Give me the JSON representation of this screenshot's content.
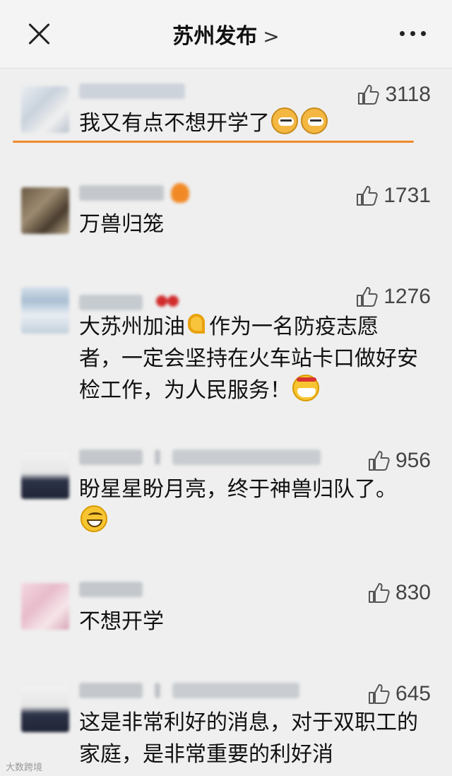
{
  "header": {
    "title": "苏州发布",
    "title_chevron": ">"
  },
  "comments": [
    {
      "text": "我又有点不想开学了",
      "likes": "3118"
    },
    {
      "text": "万兽归笼",
      "likes": "1731"
    },
    {
      "text_a": "大苏州加油",
      "text_b": "作为一名防疫志愿者，一定会坚持在火车站卡口做好安检工作，为人民服务！",
      "likes": "1276"
    },
    {
      "text": "盼星星盼月亮，终于神兽归队了。",
      "likes": "956"
    },
    {
      "text": "不想开学",
      "likes": "830"
    },
    {
      "text": "这是非常利好的消息，对于双职工的家庭，是非常重要的利好消",
      "likes": "645"
    }
  ],
  "icons": {
    "close": "close-icon",
    "more": "more-icon",
    "like": "thumb-up-icon"
  },
  "colors": {
    "accent_underline": "#f08a2a"
  },
  "watermark": "大数跨境"
}
